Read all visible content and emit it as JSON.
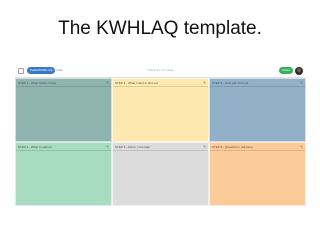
{
  "slide": {
    "title": "The KWHLAQ template."
  },
  "app": {
    "topbar": {
      "app_icon": "grid-icon",
      "pill_label": "Padlet/KWHLAQ",
      "link_label": "Remake",
      "center_label": "KWHLAQ Template",
      "share_label": "Share",
      "avatar": "user-avatar"
    },
    "sections": [
      {
        "label": "STEP 1 - What I think I know",
        "color": "#8fb3ae"
      },
      {
        "label": "STEP 2 - What I want to find out",
        "color": "#fde8b0"
      },
      {
        "label": "STEP 3 - How will I find out",
        "color": "#92b0c8"
      },
      {
        "label": "STEP 4 - What I Learned",
        "color": "#a8dcc0"
      },
      {
        "label": "STEP 5 - Action I can take",
        "color": "#dcdcdc"
      },
      {
        "label": "STEP 6 - Questions I still have",
        "color": "#fccb9a"
      }
    ],
    "edit_icon": "pencil-icon"
  }
}
